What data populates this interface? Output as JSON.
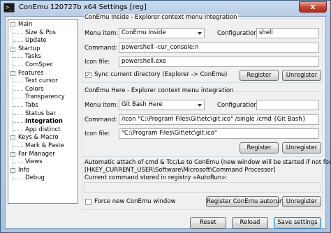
{
  "window": {
    "title": "ConEmu 120727b x64 Settings [reg]",
    "close_glyph": "x",
    "app_icon_glyph": ">_"
  },
  "tree": [
    {
      "label": "Main",
      "level": 0,
      "expander": "-"
    },
    {
      "label": "Size & Pos",
      "level": 1
    },
    {
      "label": "Update",
      "level": 1
    },
    {
      "label": "Startup",
      "level": 0,
      "expander": "-"
    },
    {
      "label": "Tasks",
      "level": 1
    },
    {
      "label": "ComSpec",
      "level": 1
    },
    {
      "label": "Features",
      "level": 0,
      "expander": "-"
    },
    {
      "label": "Text cursor",
      "level": 1
    },
    {
      "label": "Colors",
      "level": 1
    },
    {
      "label": "Transparency",
      "level": 1
    },
    {
      "label": "Tabs",
      "level": 1
    },
    {
      "label": "Status bar",
      "level": 1
    },
    {
      "label": "Integration",
      "level": 1,
      "selected": true
    },
    {
      "label": "App distinct",
      "level": 1
    },
    {
      "label": "Keys & Macro",
      "level": 0,
      "expander": "-"
    },
    {
      "label": "Mark & Paste",
      "level": 1
    },
    {
      "label": "Far Manager",
      "level": 0,
      "expander": "-"
    },
    {
      "label": "Views",
      "level": 1
    },
    {
      "label": "Info",
      "level": 0,
      "expander": "-"
    },
    {
      "label": "Debug",
      "level": 1
    }
  ],
  "inside": {
    "group_title": "ConEmu Inside - Explorer context menu integration",
    "menu_item_label": "Menu item:",
    "menu_item_value": "ConEmu Inside",
    "configuration_label": "Configuration:",
    "configuration_value": "shell",
    "command_label": "Command:",
    "command_value": "powershell -cur_console:n",
    "icon_file_label": "Icon file:",
    "icon_file_value": "powershell.exe",
    "sync_label": "Sync current directory (Explorer -> ConEmu)",
    "sync_checked": true,
    "register_label": "Register",
    "unregister_label": "Unregister"
  },
  "here": {
    "group_title": "ConEmu Here - Explorer context menu integration",
    "menu_item_label": "Menu item:",
    "menu_item_value": "Git Bash Here",
    "configuration_label": "Configuration:",
    "configuration_value": "",
    "command_label": "Command:",
    "command_value": "/icon \"C:\\Program Files\\Git\\etc\\git.ico\" /single /cmd {Git Bash}",
    "icon_file_label": "Icon file:",
    "icon_file_value": "\"C:\\Program Files\\Git\\etc\\git.ico\"",
    "register_label": "Register",
    "unregister_label": "Unregister"
  },
  "autorun": {
    "group_title": "Automatic attach of cmd & Tcc/Le to ConEmu (new window will be started if not found)",
    "registry_key": "[HKEY_CURRENT_USER\\Software\\Microsoft\\Command Processor]",
    "current_command_label": "Current command stored in registry «AutoRun»:",
    "current_command_value": "",
    "force_new_label": "Force new ConEmu window",
    "force_new_checked": false,
    "register_label": "Register ConEmu autorun",
    "unregister_label": "Unregister"
  },
  "footer": {
    "reset_label": "Reset",
    "reload_label": "Reload",
    "save_label": "Save settings"
  }
}
